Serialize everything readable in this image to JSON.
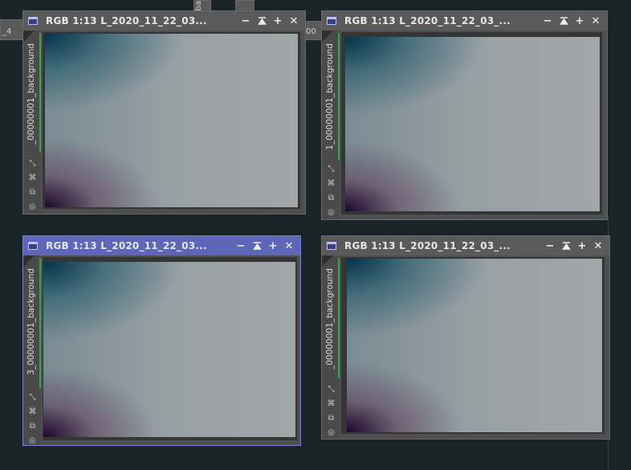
{
  "background_tabs": [
    {
      "label": "_4"
    },
    {
      "label": "ba"
    },
    {
      "label": "00"
    }
  ],
  "windows": [
    {
      "title": "RGB 1:13 L_2020_11_22_03...",
      "side_label": "_00000001_background",
      "active": false
    },
    {
      "title": "RGB 1:13 L_2020_11_22_03_...",
      "side_label": "1_00000001_background",
      "active": false
    },
    {
      "title": "RGB 1:13 L_2020_11_22_03...",
      "side_label": "3_00000001_background",
      "active": true
    },
    {
      "title": "RGB 1:13 L_2020_11_22_03_...",
      "side_label": "_00000001_background",
      "active": false
    }
  ],
  "controls": {
    "minimize": "−",
    "shade": "⌅",
    "maximize": "+",
    "close": "✕"
  },
  "icons": [
    "image-window-icon",
    "minimize-icon",
    "shade-icon",
    "maximize-icon",
    "close-icon",
    "zoom-fit-icon",
    "crosshair-icon",
    "clone-icon",
    "target-icon"
  ],
  "colors": {
    "workspace": "#1a2428",
    "titlebar": "#5a5a5a",
    "titlebar_active": "#5e66b8",
    "mask_indicator": "#2fa84f"
  }
}
